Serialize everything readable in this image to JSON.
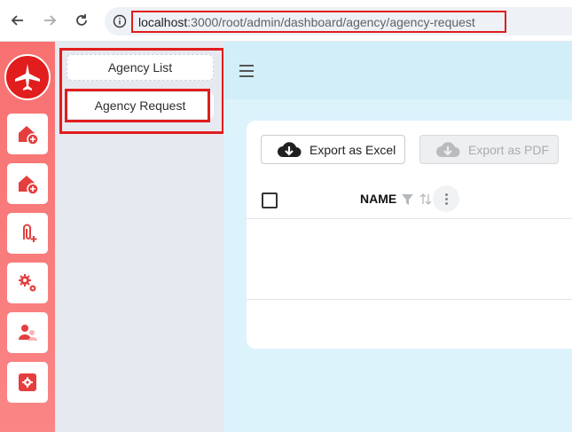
{
  "browser": {
    "url_host": "localhost",
    "url_path": ":3000/root/admin/dashboard/agency/agency-request",
    "back_icon": "arrow-left-icon",
    "forward_icon": "arrow-right-icon",
    "reload_icon": "reload-icon",
    "info_icon": "info-icon"
  },
  "sidebar": {
    "logo_icon": "airplane-logo-icon",
    "items": [
      {
        "icon": "house-plus-icon"
      },
      {
        "icon": "house-plus-icon"
      },
      {
        "icon": "paperclip-plus-icon"
      },
      {
        "icon": "gears-icon"
      },
      {
        "icon": "users-icon"
      },
      {
        "icon": "settings-square-icon"
      }
    ]
  },
  "submenu": {
    "items": [
      {
        "label": "Agency List"
      },
      {
        "label": "Agency Request"
      }
    ]
  },
  "toolbar": {
    "menu_icon": "hamburger-icon",
    "export_excel": "Export as Excel",
    "export_pdf": "Export as PDF"
  },
  "table": {
    "columns": [
      {
        "label": "NAME"
      }
    ]
  },
  "colors": {
    "accent": "#e11d1d",
    "rail": "#f87171",
    "main_bg": "#ddf3fc"
  }
}
